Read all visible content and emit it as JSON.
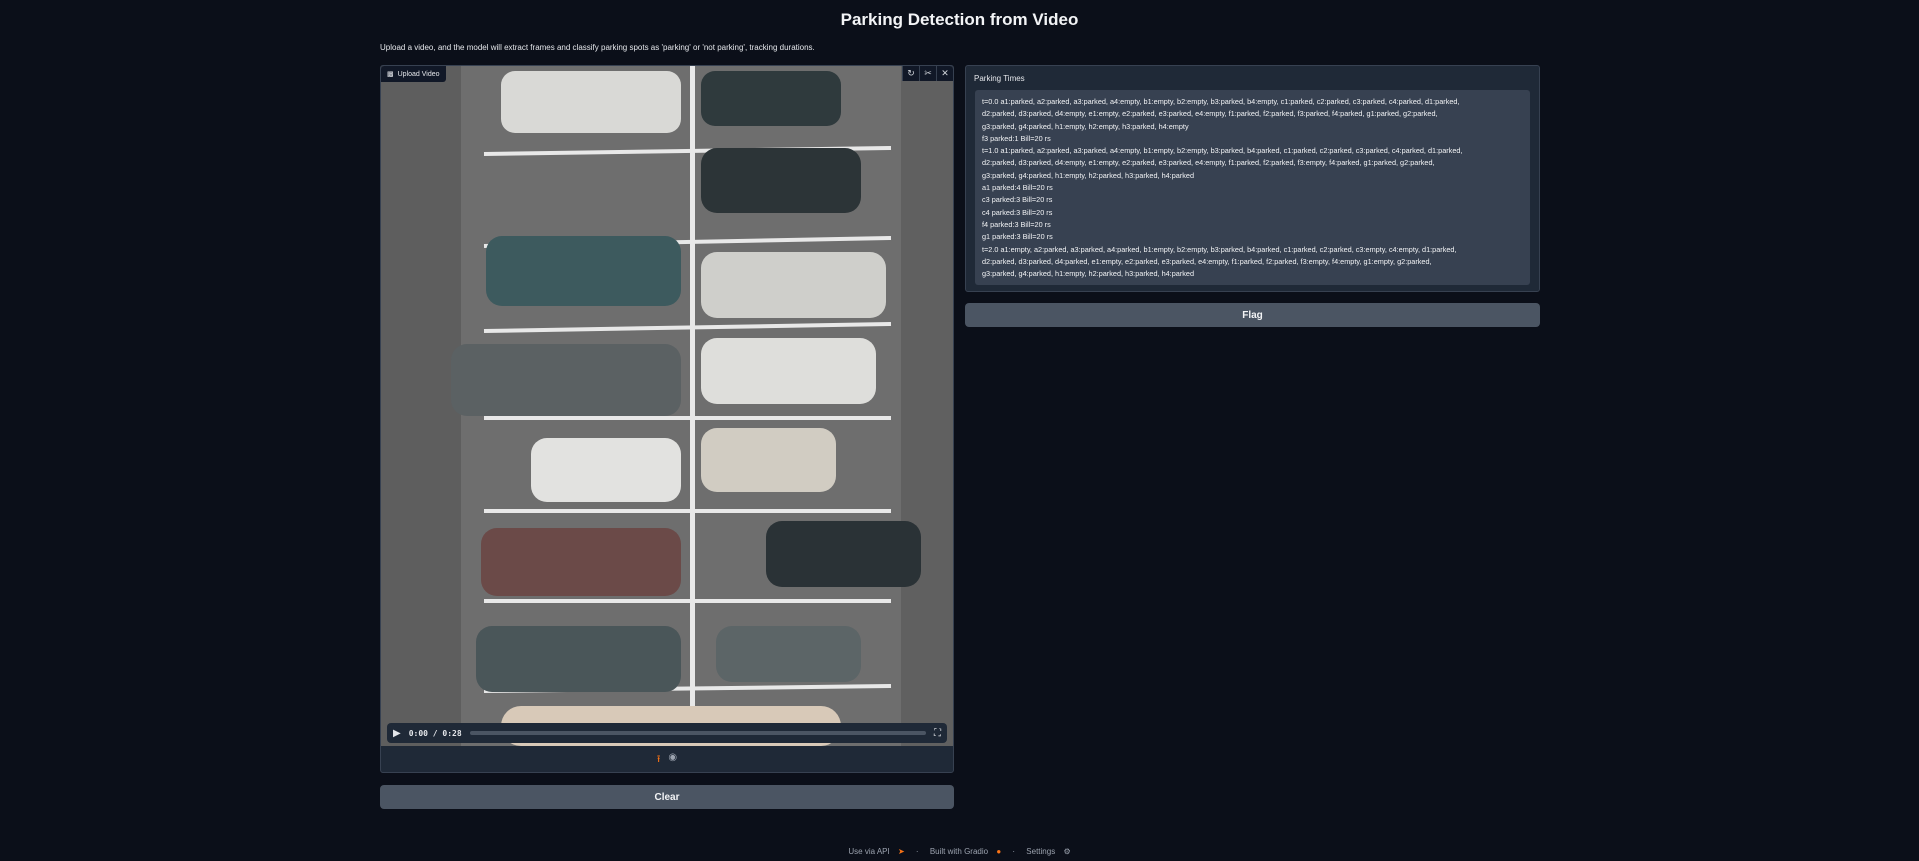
{
  "page": {
    "title": "Parking Detection from Video",
    "description": "Upload a video, and the model will extract frames and classify parking spots as 'parking' or 'not parking', tracking durations."
  },
  "video": {
    "label": "Upload Video",
    "icon": "video-icon",
    "corner_buttons": [
      "undo-icon",
      "edit-icon",
      "close-icon"
    ],
    "time": "0:00 / 0:28",
    "progress": 0,
    "bottom_icons": [
      "upload-icon",
      "webcam-icon"
    ]
  },
  "buttons": {
    "clear": "Clear",
    "flag": "Flag"
  },
  "parking_times": {
    "label": "Parking Times",
    "lines": [
      "t=0.0 a1:parked, a2:parked, a3:parked, a4:empty, b1:empty, b2:empty, b3:parked, b4:empty, c1:parked, c2:parked, c3:parked, c4:parked, d1:parked,",
      "d2:parked, d3:parked, d4:empty, e1:empty, e2:parked, e3:parked, e4:empty, f1:parked, f2:parked, f3:parked, f4:parked, g1:parked, g2:parked,",
      "g3:parked, g4:parked, h1:empty, h2:empty, h3:parked, h4:empty",
      "f3 parked:1 Bill=20 rs",
      "t=1.0 a1:parked, a2:parked, a3:parked, a4:empty, b1:empty, b2:empty, b3:parked, b4:parked, c1:parked, c2:parked, c3:parked, c4:parked, d1:parked,",
      "d2:parked, d3:parked, d4:empty, e1:empty, e2:parked, e3:parked, e4:empty, f1:parked, f2:parked, f3:empty, f4:parked, g1:parked, g2:parked,",
      "g3:parked, g4:parked, h1:empty, h2:parked, h3:parked, h4:parked",
      "a1 parked:4 Bill=20 rs",
      "c3 parked:3 Bill=20 rs",
      "c4 parked:3 Bill=20 rs",
      "f4 parked:3 Bill=20 rs",
      "g1 parked:3 Bill=20 rs",
      "t=2.0 a1:empty, a2:parked, a3:parked, a4:parked, b1:empty, b2:empty, b3:parked, b4:parked, c1:parked, c2:parked, c3:empty, c4:empty, d1:parked,",
      "d2:parked, d3:parked, d4:parked, e1:empty, e2:parked, e3:parked, e4:empty, f1:parked, f2:parked, f3:empty, f4:empty, g1:empty, g2:parked,",
      "g3:parked, g4:parked, h1:empty, h2:parked, h3:parked, h4:parked"
    ]
  },
  "footer": {
    "api": "Use via API",
    "built": "Built with Gradio",
    "settings": "Settings",
    "sep": "·"
  },
  "colors": {
    "background": "#0b0f19",
    "panel": "#1f2937",
    "button": "#4b5563",
    "accent": "#f97316"
  }
}
